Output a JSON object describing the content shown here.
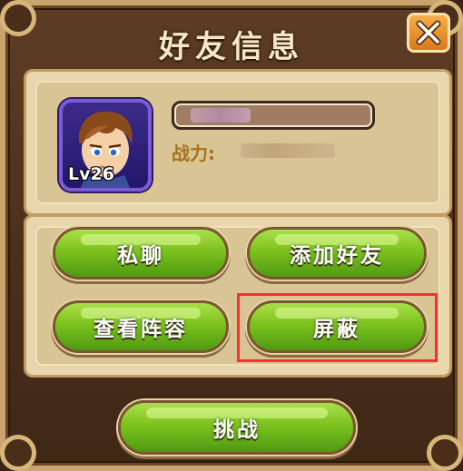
{
  "dialog": {
    "title": "好友信息",
    "close_icon": "close-x-icon"
  },
  "profile": {
    "level": "Lv26",
    "name": "",
    "power_label": "战力:",
    "power_value": ""
  },
  "actions": {
    "private_chat": "私聊",
    "add_friend": "添加好友",
    "view_lineup": "查看阵容",
    "block": "屏蔽",
    "challenge": "挑战"
  },
  "colors": {
    "frame": "#4a2e1a",
    "panel": "#e8d6ad",
    "button_green": "#7dc21e",
    "close_orange": "#e8901f",
    "highlight_red": "#ff2d2d"
  }
}
